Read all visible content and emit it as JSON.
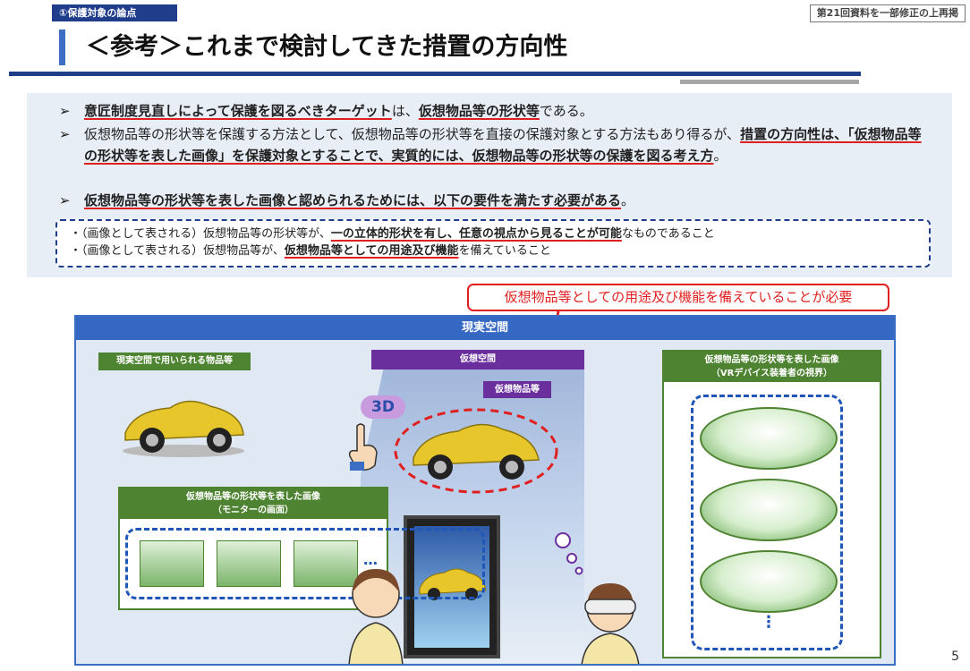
{
  "header": {
    "section_tag": "①保護対象の論点",
    "note_badge": "第21回資料を一部修正の上再掲",
    "title": "＜参考＞これまで検討してきた措置の方向性"
  },
  "summary": {
    "bullet_glyph": "➢",
    "b1": {
      "u1": "意匠制度見直しによって保護を図るべきターゲット",
      "t1": "は、",
      "u2": "仮想物品等の形状等",
      "t2": "である。"
    },
    "b2": {
      "t1": "仮想物品等の形状等を保護する方法として、仮想物品等の形状等を直接の保護対象とする方法もあり得るが、",
      "u1": "措置の方向性は、「仮想物品等の形状等を表した画像」を保護対象とすることで、実質的には、仮想物品等の形状等の保護を図る考え方",
      "t2": "。"
    },
    "b3": {
      "u1": "仮想物品等の形状等を表した画像と認められるためには、以下の要件を満たす必要がある",
      "t1": "。"
    },
    "req1": {
      "t1": "・（画像として表される）仮想物品等の形状等が、",
      "u1": "一の立体的形状を有し、任意の視点から見ることが可能",
      "t2": "なものであること"
    },
    "req2": {
      "t1": "・（画像として表される）仮想物品等が、",
      "u1": "仮想物品等としての用途及び機能",
      "t2": "を備えていること"
    }
  },
  "callout": "仮想物品等としての用途及び機能を備えていることが必要",
  "diagram": {
    "panel_title": "現実空間",
    "real_label": "現実空間で用いられる物品等",
    "virtual_space": "仮想空間",
    "virtual_object": "仮想物品等",
    "badge_3d": "3D",
    "image_label_l1": "仮想物品等の形状等を表した画像",
    "image_label_l2": "（モニターの画面）",
    "vr_label_l1": "仮想物品等の形状等を表した画像",
    "vr_label_l2": "（VRデバイス装着者の視界）",
    "ellipsis_h": "…",
    "ellipsis_v": "⋮"
  },
  "page_number": "5",
  "colors": {
    "navy": "#1f3d8a",
    "accent_red": "#e02020",
    "green": "#4e8431",
    "purple": "#6a2f9c",
    "panel_bg": "#dfe8f3"
  }
}
